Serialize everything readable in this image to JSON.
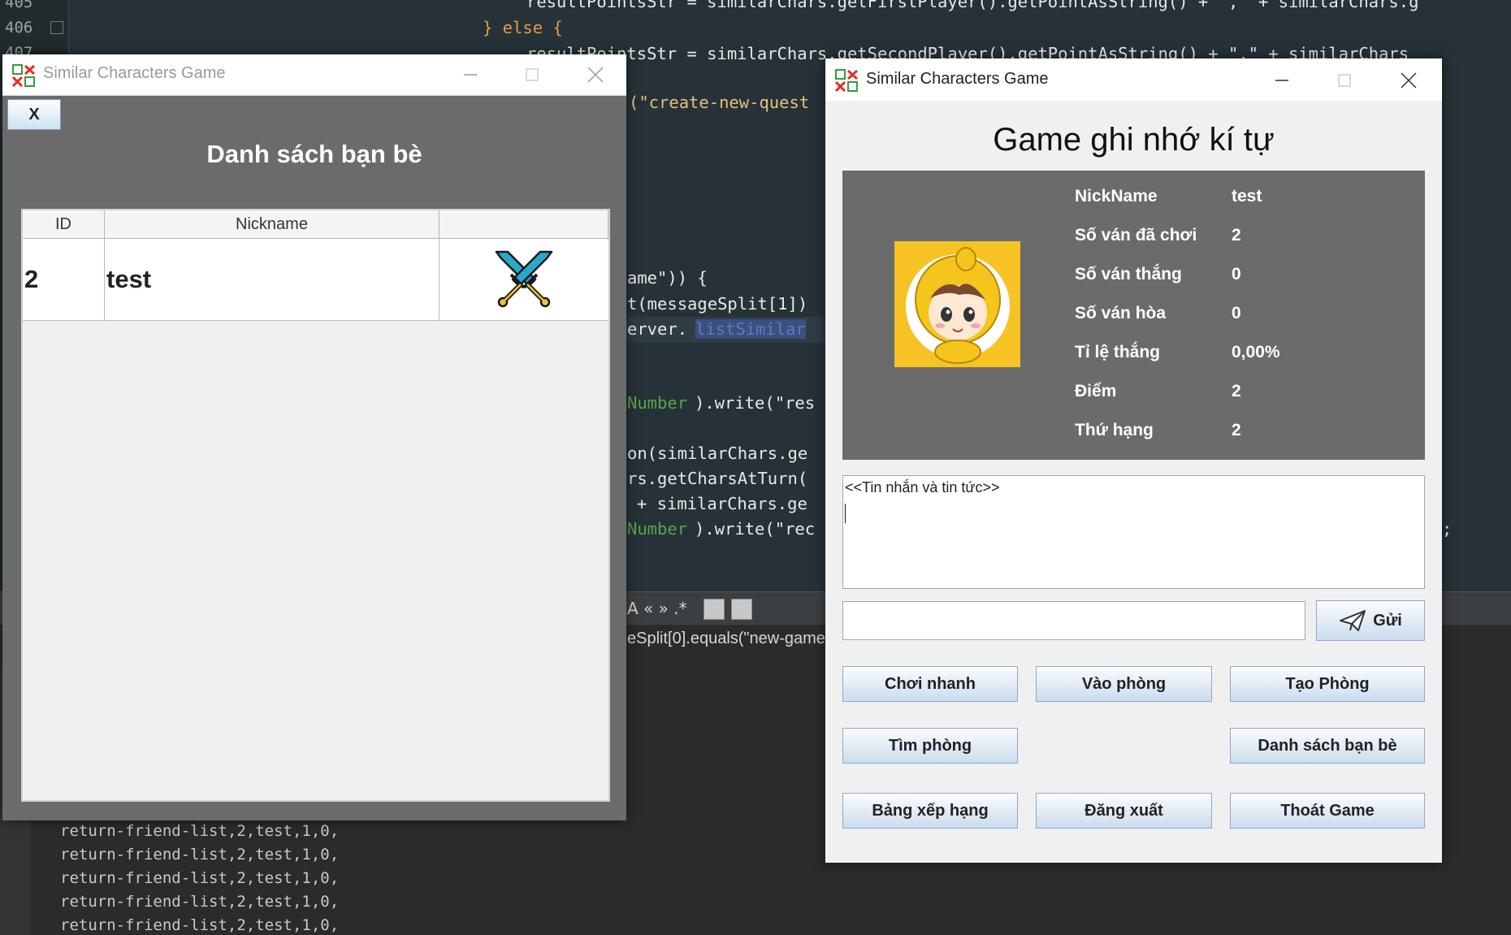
{
  "ide": {
    "line_numbers": [
      "405",
      "406",
      "407"
    ],
    "code": {
      "l1": "resultPointsStr = similarChars.getFirstPlayer().getPointAsString() + \",\" + similarChars.g",
      "l2_kw": "} else {",
      "l3": "resultPointsStr = similarChars.getSecondPlayer().getPointAsString() + \",\" + similarChars",
      "create_quest": "(\"create-new-quest",
      "ame": "ame\")) {",
      "message_split": "t(messageSplit[1])",
      "erver": "erver.",
      "list_similar": "listSimilar",
      "number_write_res_a": "Number",
      "number_write_res_b": ").write(\"res",
      "on_similar": "on(similarChars.ge",
      "rs_get_chars": "rs.getCharsAtTurn(",
      "plus_similar": "+ similarChars.ge",
      "number_write_rec_a": "Number",
      "number_write_rec_b": ").write(\"rec",
      "semicolon": ";"
    },
    "search_toolbar": "A « » .*",
    "replace_text": "eSplit[0].equals(\"new-game",
    "output_lines": [
      "return-friend-list,2,test,1,0,",
      "return-friend-list,2,test,1,0,",
      "return-friend-list,2,test,1,0,",
      "return-friend-list,2,test,1,0,",
      "return-friend-list,2,test,1,0,"
    ]
  },
  "friends_window": {
    "title": "Similar Characters Game",
    "close_label": "X",
    "heading": "Danh sách bạn bè",
    "columns": [
      "ID",
      "Nickname",
      ""
    ],
    "rows": [
      {
        "id": "2",
        "nickname": "test",
        "action_icon": "crossed-swords-icon"
      }
    ]
  },
  "main_window": {
    "title": "Similar Characters Game",
    "game_title": "Game ghi nhớ kí tự",
    "avatar_icon": "chick-costume-avatar",
    "stats": [
      {
        "label": "NickName",
        "value": "test"
      },
      {
        "label": "Số ván đã chơi",
        "value": "2"
      },
      {
        "label": "Số ván thắng",
        "value": "0"
      },
      {
        "label": "Số ván hòa",
        "value": "0"
      },
      {
        "label": "Tỉ lệ thắng",
        "value": "0,00%"
      },
      {
        "label": "Điểm",
        "value": "2"
      },
      {
        "label": "Thứ hạng",
        "value": "2"
      }
    ],
    "message_area_text": "<<Tin nhắn và tin tức>>",
    "chat_input_value": "",
    "send_label": "Gửi",
    "buttons": {
      "quick_play": "Chơi nhanh",
      "join_room": "Vào phòng",
      "create_room": "Tạo Phòng",
      "find_room": "Tìm phòng",
      "friend_list": "Danh sách bạn bè",
      "leaderboard": "Bảng xếp hạng",
      "logout": "Đăng xuất",
      "exit_game": "Thoát Game"
    }
  },
  "colors": {
    "panel_gray": "#6b6b6b",
    "button_border": "#8fa8c8",
    "sword_blue": "#2aa7c9",
    "avatar_bg": "#f7c224"
  }
}
